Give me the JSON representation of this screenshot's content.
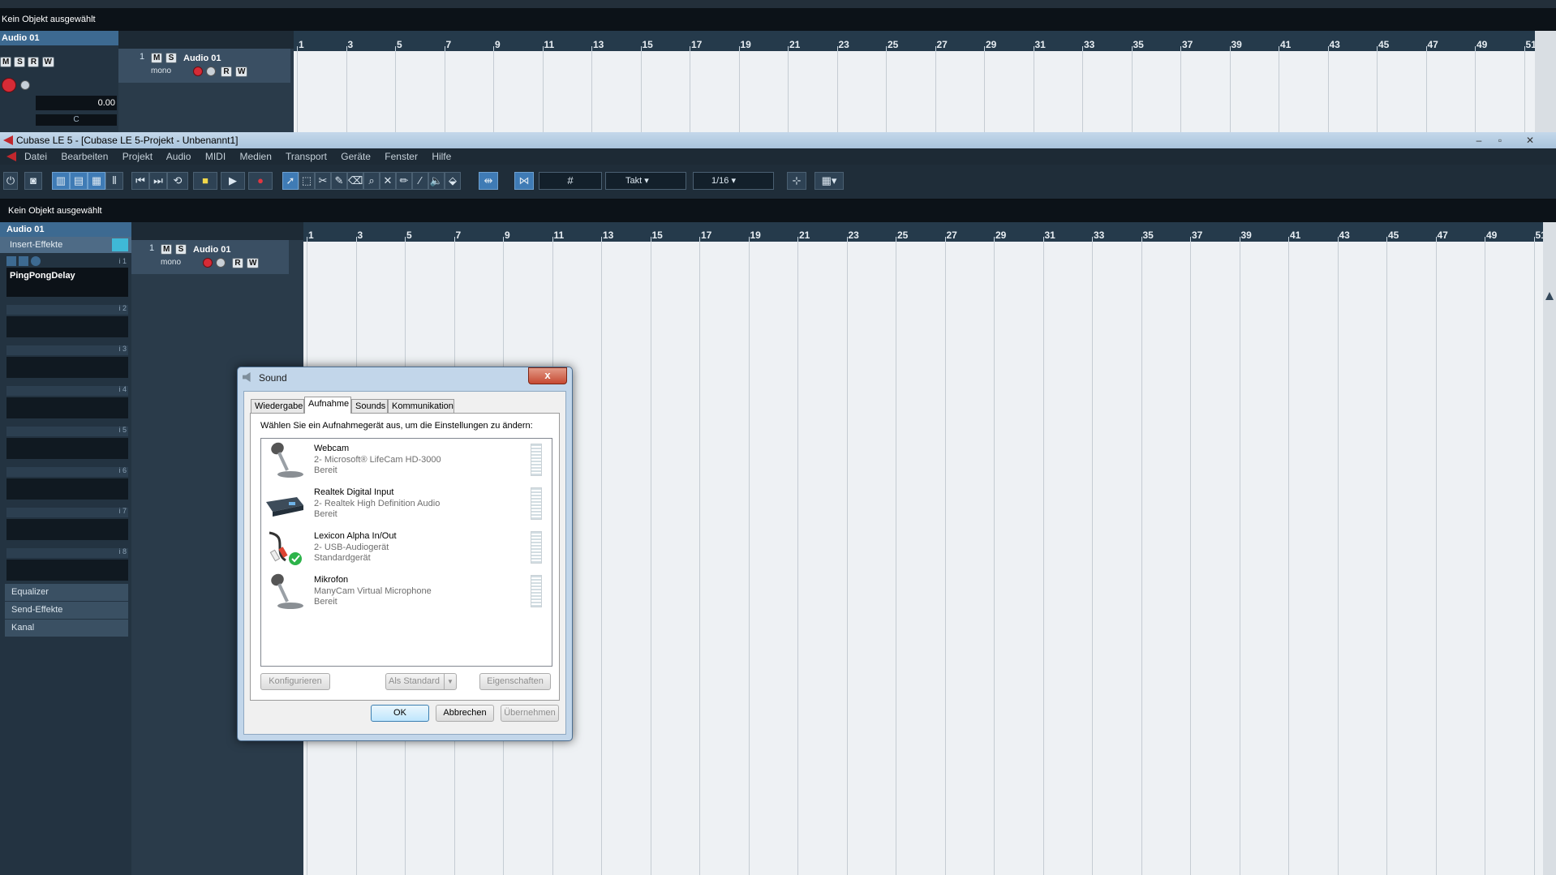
{
  "background_window": {
    "info_line": "Kein Objekt ausgewählt",
    "inspector_track": "Audio 01",
    "track_buttons": [
      "M",
      "S",
      "R",
      "W"
    ],
    "volume_value": "0.00",
    "pan_label": "C",
    "track": {
      "number": "1",
      "name": "Audio 01",
      "mode": "mono"
    }
  },
  "main_window": {
    "title": "Cubase LE 5 - [Cubase LE 5-Projekt - Unbenannt1]",
    "menu": [
      "Datei",
      "Bearbeiten",
      "Projekt",
      "Audio",
      "MIDI",
      "Medien",
      "Transport",
      "Geräte",
      "Fenster",
      "Hilfe"
    ],
    "toolbar": {
      "grid_type": "Takt",
      "quantize": "1/16"
    },
    "info_line": "Kein Objekt ausgewählt",
    "inspector": {
      "track_name": "Audio 01",
      "insert_label": "Insert-Effekte",
      "slot1_plugin": "PingPongDelay",
      "slot_numbers": [
        "i 1",
        "i 2",
        "i 3",
        "i 4",
        "i 5",
        "i 6",
        "i 7",
        "i 8"
      ],
      "sections": [
        "Equalizer",
        "Send-Effekte",
        "Kanal"
      ]
    },
    "track": {
      "number": "1",
      "name": "Audio 01",
      "mode": "mono",
      "buttons": [
        "M",
        "S",
        "R",
        "W"
      ]
    }
  },
  "ruler_numbers": [
    "1",
    "3",
    "5",
    "7",
    "9",
    "11",
    "13",
    "15",
    "17",
    "19",
    "21",
    "23",
    "25",
    "27",
    "29",
    "31",
    "33",
    "35",
    "37",
    "39",
    "41",
    "43",
    "45",
    "47",
    "49",
    "51"
  ],
  "dialog": {
    "title": "Sound",
    "close_label": "x",
    "tabs": [
      "Wiedergabe",
      "Aufnahme",
      "Sounds",
      "Kommunikation"
    ],
    "active_tab": "Aufnahme",
    "instruction": "Wählen Sie ein Aufnahmegerät aus, um die Einstellungen zu ändern:",
    "devices": [
      {
        "name": "Webcam",
        "driver": "2- Microsoft® LifeCam HD-3000",
        "status": "Bereit",
        "icon": "microphone-icon"
      },
      {
        "name": "Realtek Digital Input",
        "driver": "2- Realtek High Definition Audio",
        "status": "Bereit",
        "icon": "digital-input-icon"
      },
      {
        "name": "Lexicon Alpha In/Out",
        "driver": "2- USB-Audiogerät",
        "status": "Standardgerät",
        "icon": "rca-cable-default-icon"
      },
      {
        "name": "Mikrofon",
        "driver": "ManyCam Virtual Microphone",
        "status": "Bereit",
        "icon": "microphone-icon"
      }
    ],
    "buttons": {
      "configure": "Konfigurieren",
      "set_default": "Als Standard",
      "properties": "Eigenschaften",
      "ok": "OK",
      "cancel": "Abbrechen",
      "apply": "Übernehmen"
    }
  },
  "colors": {
    "accent": "#3d6a91",
    "record": "#d62b36",
    "grid_bg": "#eef1f4"
  }
}
